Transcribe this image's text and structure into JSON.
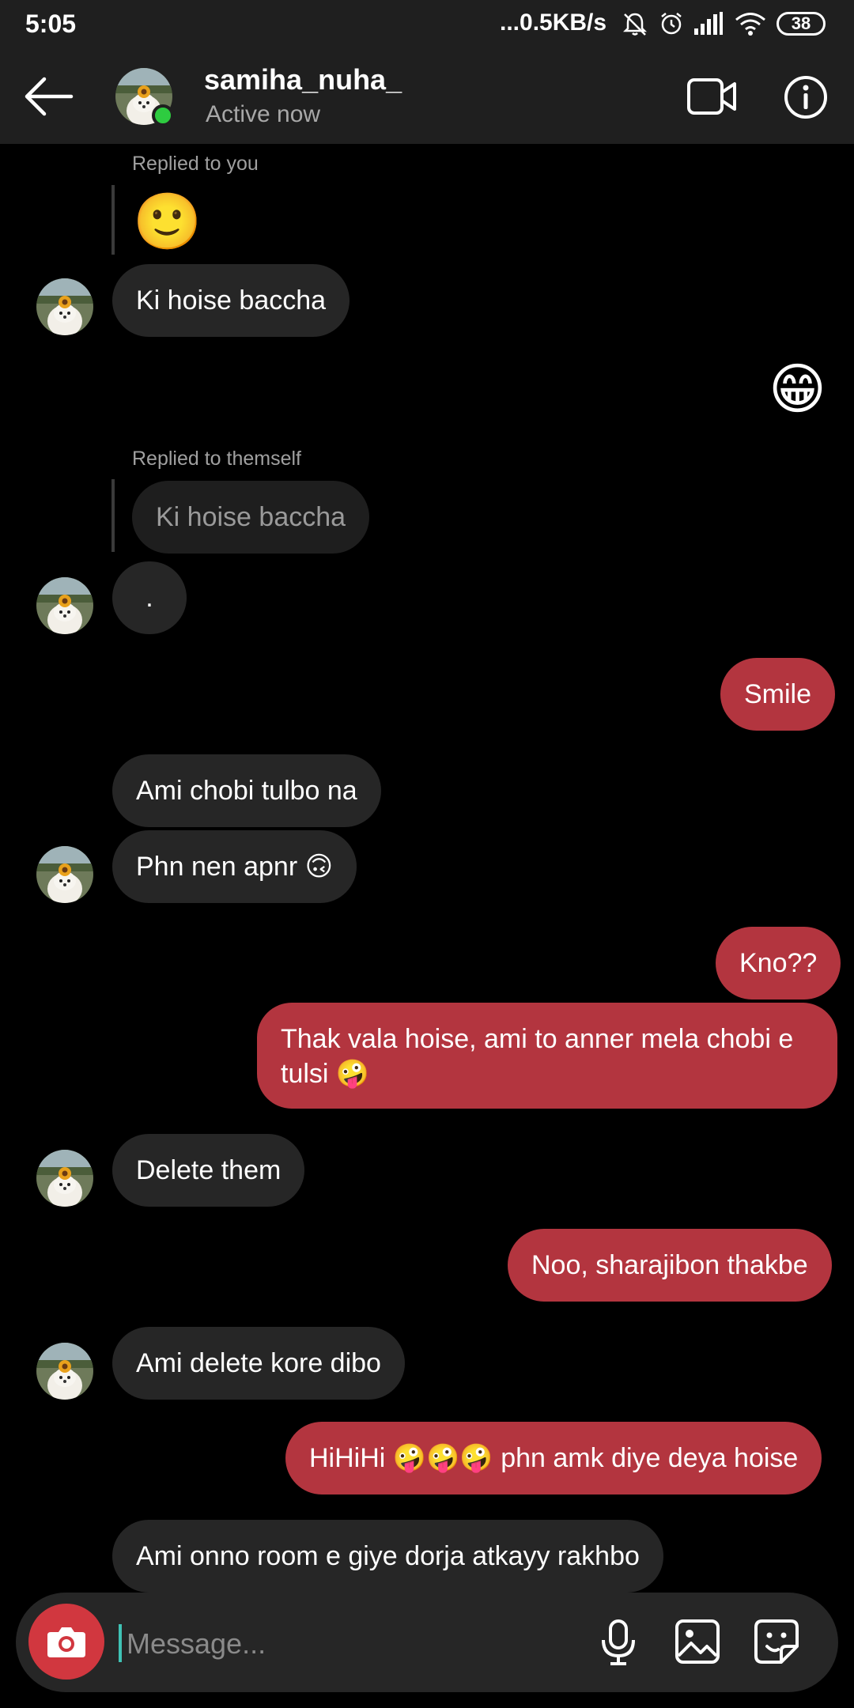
{
  "status_bar": {
    "time": "5:05",
    "network_speed": "...0.5KB/s",
    "battery": "38"
  },
  "header": {
    "username": "samiha_nuha_",
    "presence": "Active now"
  },
  "messages": {
    "m1_meta": "Replied to you",
    "m1_emoji": "🙂",
    "m2_text": "Ki hoise baccha",
    "m3_emoji": "😁",
    "m4_meta": "Replied to themself",
    "m4_quote": "Ki hoise baccha",
    "m5_text": ".",
    "m6_text": "Smile",
    "m7_text": "Ami chobi tulbo na",
    "m8_text": "Phn nen apnr 🙃",
    "m9_text": "Kno??",
    "m10_text": "Thak vala hoise, ami to anner mela chobi e tulsi 🤪",
    "m11_text": "Delete them",
    "m12_text": "Noo, sharajibon thakbe",
    "m13_text": "Ami delete kore dibo",
    "m14_text": "HiHiHi 🤪🤪🤪 phn amk diye deya hoise",
    "m15_text": "Ami onno room e giye dorja atkayy rakhbo"
  },
  "composer": {
    "placeholder": "Message..."
  },
  "colors": {
    "outgoing_bubble": "#b3353f",
    "incoming_bubble": "#262626",
    "online_dot": "#2ecc40",
    "camera_button": "#d1373f",
    "caret": "#3fc2b5"
  }
}
